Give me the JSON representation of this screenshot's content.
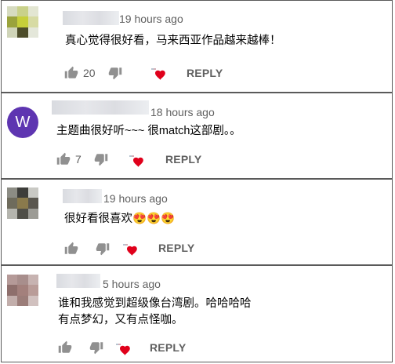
{
  "comments": [
    {
      "author_avatar": "pixelated-avatar",
      "timestamp": "19 hours ago",
      "text_lines": [
        "真心觉得很好看，马来西亚作品越来越棒！"
      ],
      "likes": "20",
      "reply_label": "REPLY"
    },
    {
      "author_avatar": "W",
      "timestamp": "18 hours ago",
      "text_lines": [
        "主题曲很好听~~~ 很match这部剧。。"
      ],
      "likes": "7",
      "reply_label": "REPLY"
    },
    {
      "author_avatar": "pixelated-avatar",
      "timestamp": "19 hours ago",
      "text_lines": [
        "很好看很喜欢😍😍😍"
      ],
      "likes": "",
      "reply_label": "REPLY"
    },
    {
      "author_avatar": "pixelated-avatar",
      "timestamp": "5 hours ago",
      "text_lines": [
        "谁和我感觉到超级像台湾剧。哈哈哈哈",
        "有点梦幻，又有点怪咖。"
      ],
      "likes": "",
      "reply_label": "REPLY"
    }
  ],
  "icons": {
    "like": "thumbs-up-icon",
    "dislike": "thumbs-down-icon",
    "creator_heart": "creator-heart-icon"
  },
  "colors": {
    "border": "#5a5a5a",
    "meta_text": "#606060",
    "avatar_w": "#5e35b1",
    "heart": "#e0001b"
  }
}
